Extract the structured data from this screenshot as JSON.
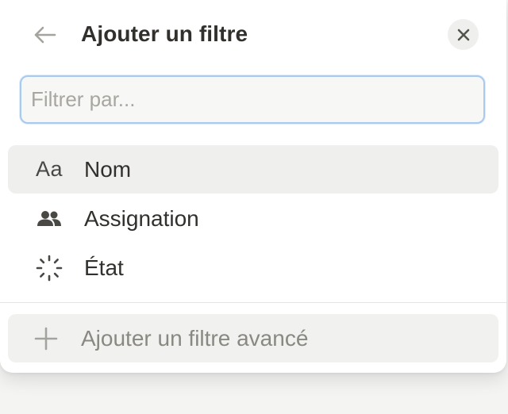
{
  "header": {
    "title": "Ajouter un filtre",
    "back_icon": "arrow-left-icon",
    "close_icon": "close-icon"
  },
  "search": {
    "value": "",
    "placeholder": "Filtrer par..."
  },
  "properties": [
    {
      "label": "Nom",
      "icon": "text-aa-icon",
      "icon_text": "Aa",
      "selected": true
    },
    {
      "label": "Assignation",
      "icon": "people-icon",
      "selected": false
    },
    {
      "label": "État",
      "icon": "status-spinner-icon",
      "selected": false
    }
  ],
  "footer": {
    "add_advanced_label": "Ajouter un filtre avancé",
    "icon": "plus-icon"
  },
  "colors": {
    "focus_ring": "#a9c9ee",
    "text_primary": "#32302c",
    "text_muted": "#8a8882",
    "selected_bg": "#efefee"
  }
}
